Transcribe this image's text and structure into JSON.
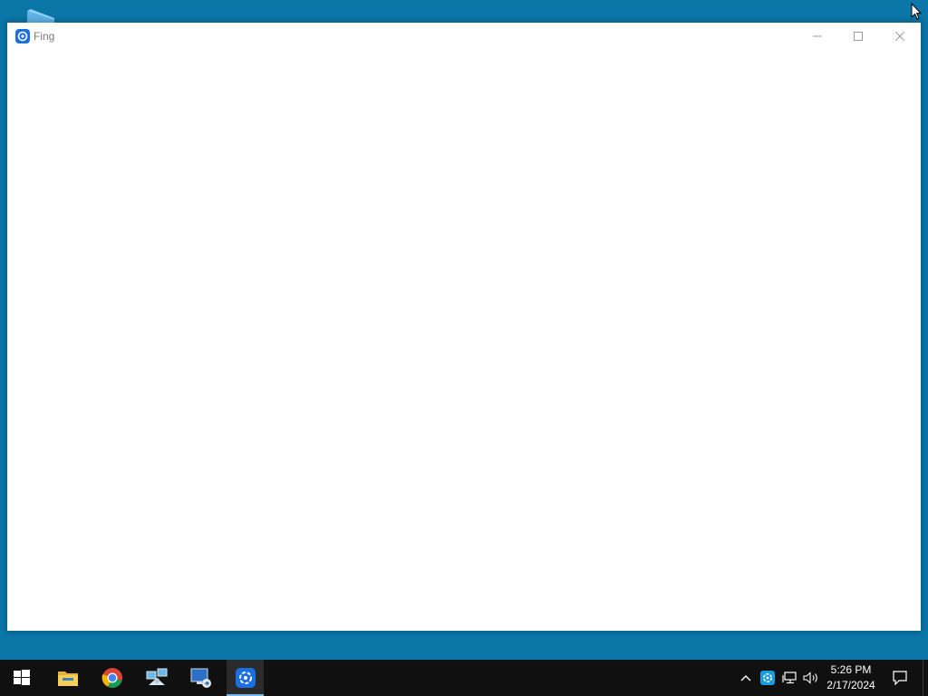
{
  "window": {
    "title": "Fing",
    "controls": {
      "minimize": "minimize",
      "maximize": "maximize",
      "close": "close"
    }
  },
  "taskbar": {
    "apps": [
      {
        "name": "start",
        "icon": "windows-logo-icon"
      },
      {
        "name": "file-explorer",
        "icon": "folder-icon"
      },
      {
        "name": "chrome",
        "icon": "chrome-icon"
      },
      {
        "name": "network-tool",
        "icon": "network-icon"
      },
      {
        "name": "remote-desktop",
        "icon": "remote-desktop-icon"
      },
      {
        "name": "fing",
        "icon": "fing-icon",
        "active": true
      }
    ],
    "tray": {
      "icons": [
        "chevron-up-icon",
        "fing-tray-icon",
        "network-tray-icon",
        "volume-icon"
      ],
      "time": "5:26 PM",
      "date": "2/17/2024"
    }
  },
  "colors": {
    "desktop": "#0b76a8",
    "taskbar": "#101010",
    "accent": "#76b9ed"
  }
}
